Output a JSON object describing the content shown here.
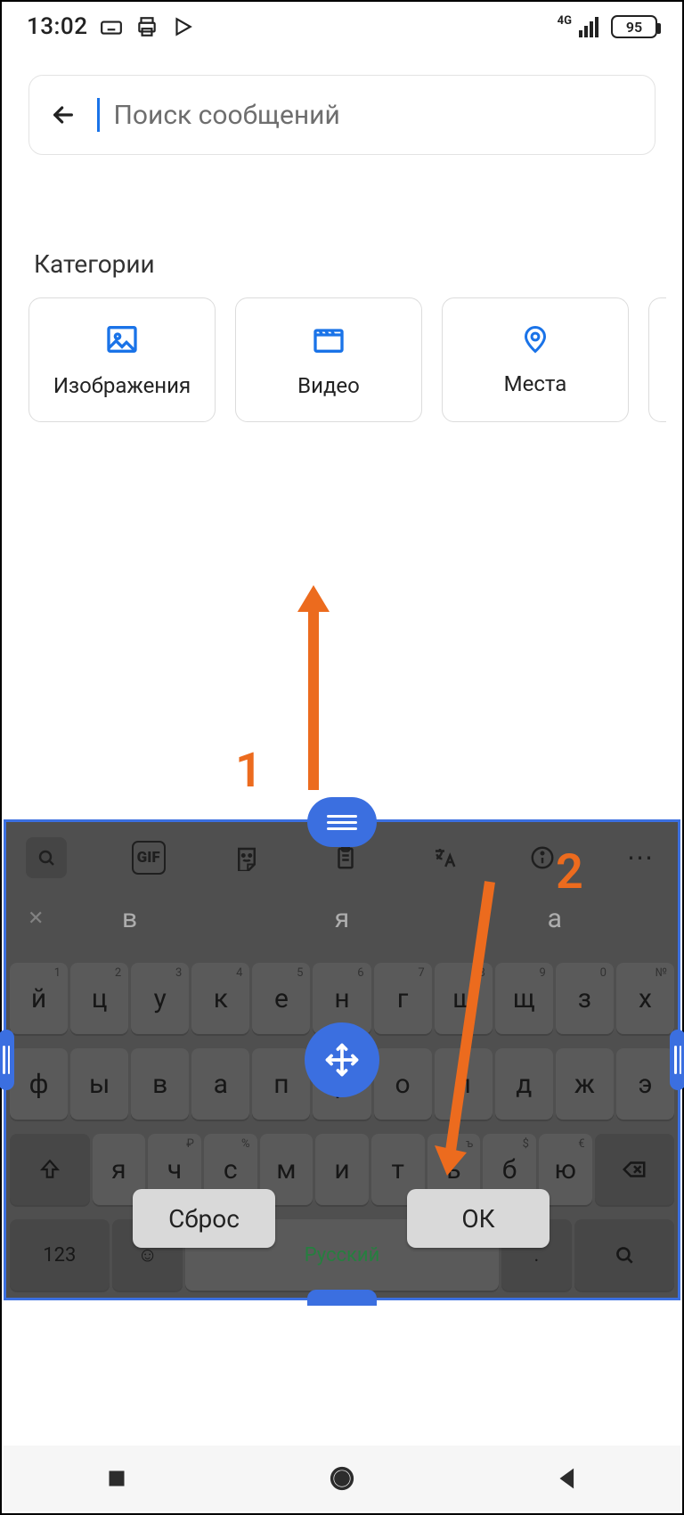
{
  "status": {
    "time": "13:02",
    "battery": "95",
    "network": "4G"
  },
  "search": {
    "placeholder": "Поиск сообщений"
  },
  "categories": {
    "title": "Категории",
    "items": [
      {
        "label": "Изображения",
        "icon": "image-icon"
      },
      {
        "label": "Видео",
        "icon": "video-icon"
      },
      {
        "label": "Места",
        "icon": "location-icon"
      }
    ]
  },
  "keyboard": {
    "toolbar_gif": "GIF",
    "suggestions": {
      "close": "✕",
      "a": "в",
      "b": "я",
      "c": "а"
    },
    "row1_alts": [
      "1",
      "2",
      "3",
      "4",
      "5",
      "6",
      "7",
      "8",
      "9",
      "0",
      "№"
    ],
    "row1": [
      "й",
      "ц",
      "у",
      "к",
      "е",
      "н",
      "г",
      "ш",
      "щ",
      "з",
      "х"
    ],
    "row2": [
      "ф",
      "ы",
      "в",
      "а",
      "п",
      "р",
      "о",
      "л",
      "д",
      "ж",
      "э"
    ],
    "row3_alts": [
      "",
      "₽",
      "%",
      "",
      "",
      "",
      "ъ",
      "$",
      "€",
      ""
    ],
    "row3": [
      "я",
      "ч",
      "с",
      "м",
      "и",
      "т",
      "ь",
      "б",
      "ю"
    ],
    "bottom": {
      "num": "123",
      "lang": "Русский"
    },
    "reset_label": "Сброс",
    "ok_label": "ОК"
  },
  "annotations": {
    "one": "1",
    "two": "2"
  }
}
